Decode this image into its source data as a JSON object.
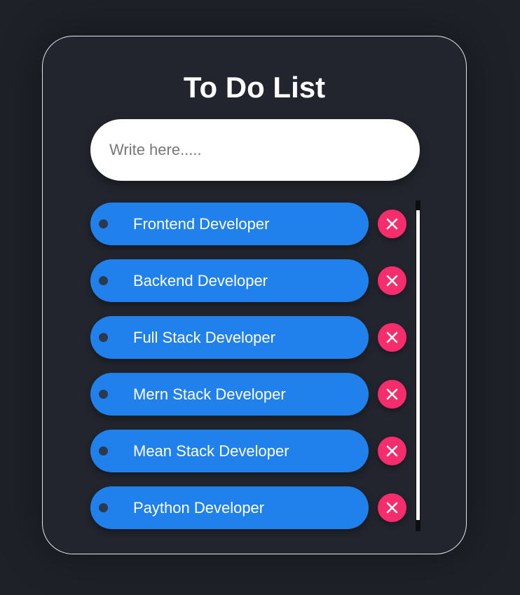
{
  "app": {
    "title": "To Do List"
  },
  "input": {
    "placeholder": "Write here.....",
    "value": ""
  },
  "todos": [
    {
      "label": "Frontend Developer"
    },
    {
      "label": "Backend Developer"
    },
    {
      "label": "Full Stack Developer"
    },
    {
      "label": "Mern Stack Developer"
    },
    {
      "label": "Mean Stack Developer"
    },
    {
      "label": "Paython Developer"
    }
  ],
  "icons": {
    "bullet": "dot-icon",
    "delete": "close-icon"
  },
  "colors": {
    "background": "#1e2128",
    "card": "#22252d",
    "item": "#2181ec",
    "delete": "#f62d6d",
    "bullet": "#2b3a4f"
  }
}
